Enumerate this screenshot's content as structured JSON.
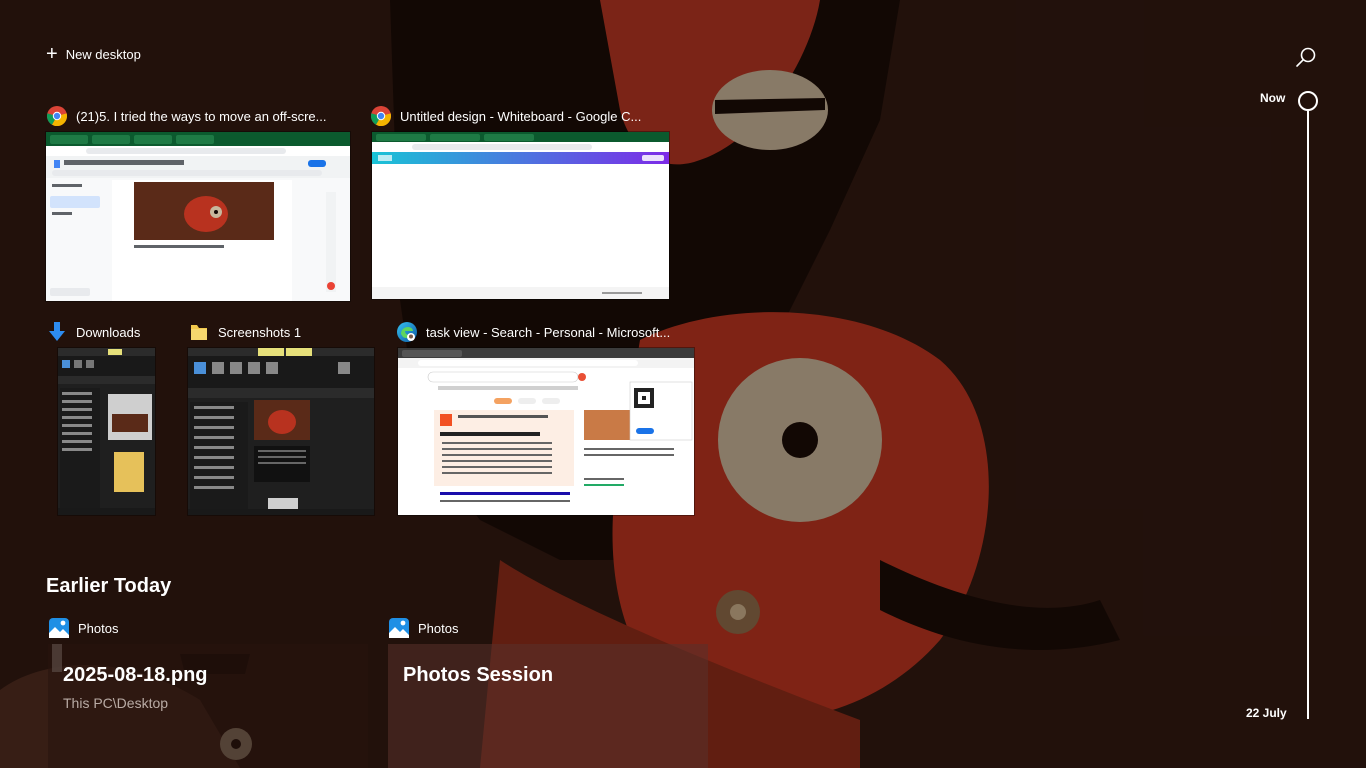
{
  "toolbar": {
    "new_desktop_label": "New desktop"
  },
  "windows": [
    {
      "title": "(21)5. I tried the ways to move an off-scre...",
      "app": "chrome"
    },
    {
      "title": "Untitled design - Whiteboard - Google C...",
      "app": "chrome"
    },
    {
      "title": "Downloads",
      "app": "downloads-folder"
    },
    {
      "title": "Screenshots 1",
      "app": "folder"
    },
    {
      "title": "task view - Search - Personal - Microsoft...",
      "app": "edge"
    }
  ],
  "timeline": {
    "section_title": "Earlier Today",
    "now_label": "Now",
    "date_label": "22 July",
    "activities": [
      {
        "app_label": "Photos",
        "title": "2025-08-18.png",
        "subtitle": "This PC\\Desktop"
      },
      {
        "app_label": "Photos",
        "title": "Photos Session"
      }
    ]
  },
  "colors": {
    "wallpaper_bg": "#2a1610",
    "accent_red": "#c0392b",
    "timeline": "#ffffff"
  }
}
